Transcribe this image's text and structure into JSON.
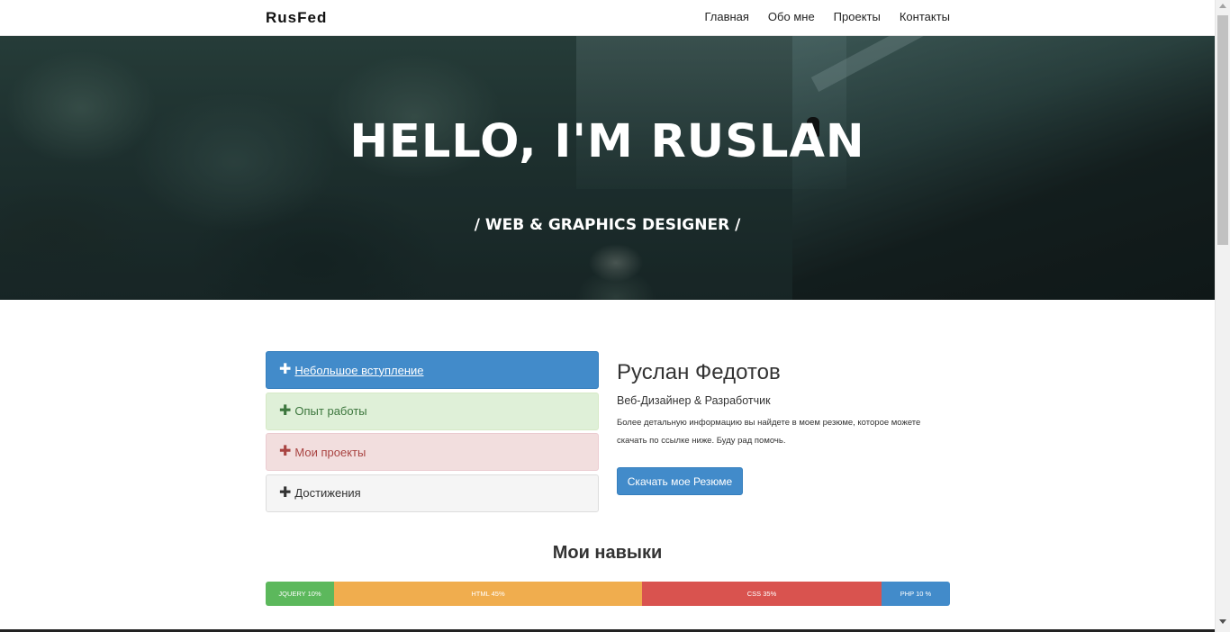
{
  "navbar": {
    "brand": "RusFed",
    "links": [
      "Главная",
      "Обо мне",
      "Проекты",
      "Контакты"
    ]
  },
  "hero": {
    "title": "HELLO, I'M RUSLAN",
    "subtitle": "/ WEB & GRAPHICS DESIGNER /"
  },
  "accordion": {
    "items": [
      {
        "label": "Небольшое вступление",
        "style": "primary"
      },
      {
        "label": "Опыт работы",
        "style": "success"
      },
      {
        "label": "Мои проекты",
        "style": "danger"
      },
      {
        "label": "Достижения",
        "style": "default"
      }
    ],
    "icon": "plus-icon"
  },
  "profile": {
    "name": "Руслан Федотов",
    "role": "Веб-Дизайнер & Разработчик",
    "description": "Более детальную информацию вы найдете в моем резюме, которое можете скачать по ссылке ниже. Буду рад помочь.",
    "button_label": "Скачать мое Резюме"
  },
  "skills": {
    "title": "Мои навыки",
    "segments": [
      {
        "label": "JQUERY 10%",
        "percent": 10,
        "color": "#5cb85c"
      },
      {
        "label": "HTML 45%",
        "percent": 45,
        "color": "#f0ad4e"
      },
      {
        "label": "CSS 35%",
        "percent": 35,
        "color": "#d9534f"
      },
      {
        "label": "PHP 10 %",
        "percent": 10,
        "color": "#428bca"
      }
    ]
  },
  "colors": {
    "primary": "#428bca",
    "success_bg": "#dff0d8",
    "danger_bg": "#f2dede",
    "default_bg": "#f5f5f5"
  }
}
